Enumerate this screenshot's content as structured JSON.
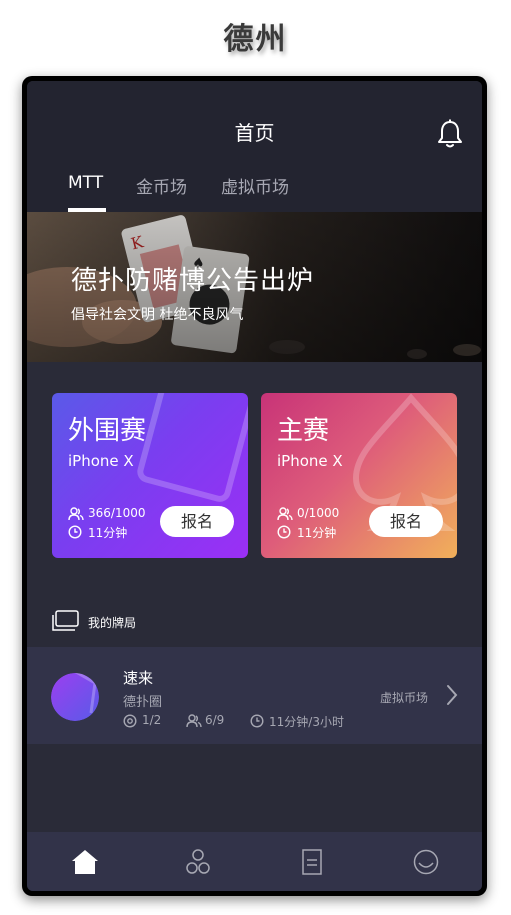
{
  "page_heading": "德州",
  "header": {
    "title": "首页",
    "tabs": [
      {
        "label": "MTT",
        "active": true
      },
      {
        "label": "金币场",
        "active": false
      },
      {
        "label": "虚拟币场",
        "active": false
      }
    ],
    "icons": {
      "notification": "bell-icon"
    }
  },
  "banner": {
    "title": "德扑防赌博公告出炉",
    "subtitle": "倡导社会文明 杜绝不良风气"
  },
  "cards": [
    {
      "title": "外围赛",
      "prize": "iPhone X",
      "players": "366/1000",
      "time": "11分钟",
      "button": "报名",
      "gradient": [
        "#5a5ae8",
        "#9b2ff5"
      ]
    },
    {
      "title": "主赛",
      "prize": "iPhone X",
      "players": "0/1000",
      "time": "11分钟",
      "button": "报名",
      "gradient": [
        "#c83378",
        "#f1b05a"
      ]
    }
  ],
  "my_games": {
    "label": "我的牌局",
    "items": [
      {
        "name": "速来",
        "club": "德扑圈",
        "blinds": "1/2",
        "players": "6/9",
        "time": "11分钟/3小时",
        "market": "虚拟币场"
      }
    ]
  },
  "bottom_nav": [
    {
      "icon": "home-icon",
      "active": true
    },
    {
      "icon": "clubs-icon",
      "active": false
    },
    {
      "icon": "records-icon",
      "active": false
    },
    {
      "icon": "profile-icon",
      "active": false
    }
  ],
  "colors": {
    "background": "#2a2b38",
    "header": "#232430",
    "panel": "#323349",
    "muted_text": "#a7a8b3"
  }
}
